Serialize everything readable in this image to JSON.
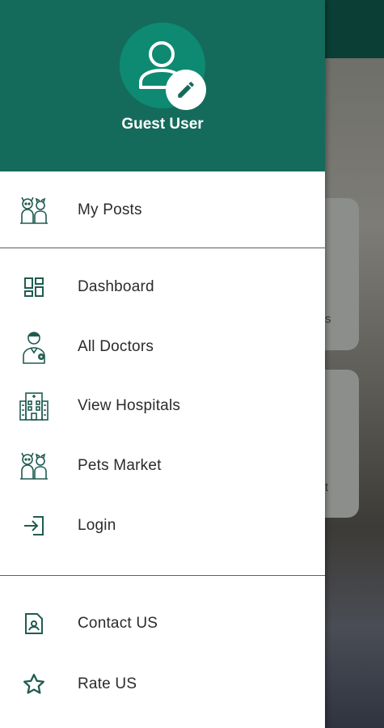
{
  "drawer": {
    "user_name": "Guest User",
    "top_items": [
      {
        "label": "My Posts",
        "icon": "pets-group-icon"
      }
    ],
    "main_items": [
      {
        "label": "Dashboard",
        "icon": "dashboard-icon"
      },
      {
        "label": "All Doctors",
        "icon": "doctor-icon"
      },
      {
        "label": "View Hospitals",
        "icon": "hospital-icon"
      },
      {
        "label": "Pets Market",
        "icon": "pets-group-icon"
      },
      {
        "label": "Login",
        "icon": "login-icon"
      }
    ],
    "bottom_items": [
      {
        "label": "Contact US",
        "icon": "contact-icon"
      },
      {
        "label": "Rate US",
        "icon": "star-icon"
      }
    ]
  },
  "background": {
    "card1_text_fragment": "s",
    "card2_text_fragment": "t"
  },
  "colors": {
    "header_green": "#156b5b",
    "avatar_green": "#0e8a72",
    "icon_green": "#1f5c50",
    "top_bar_dark": "#0b3f36"
  }
}
